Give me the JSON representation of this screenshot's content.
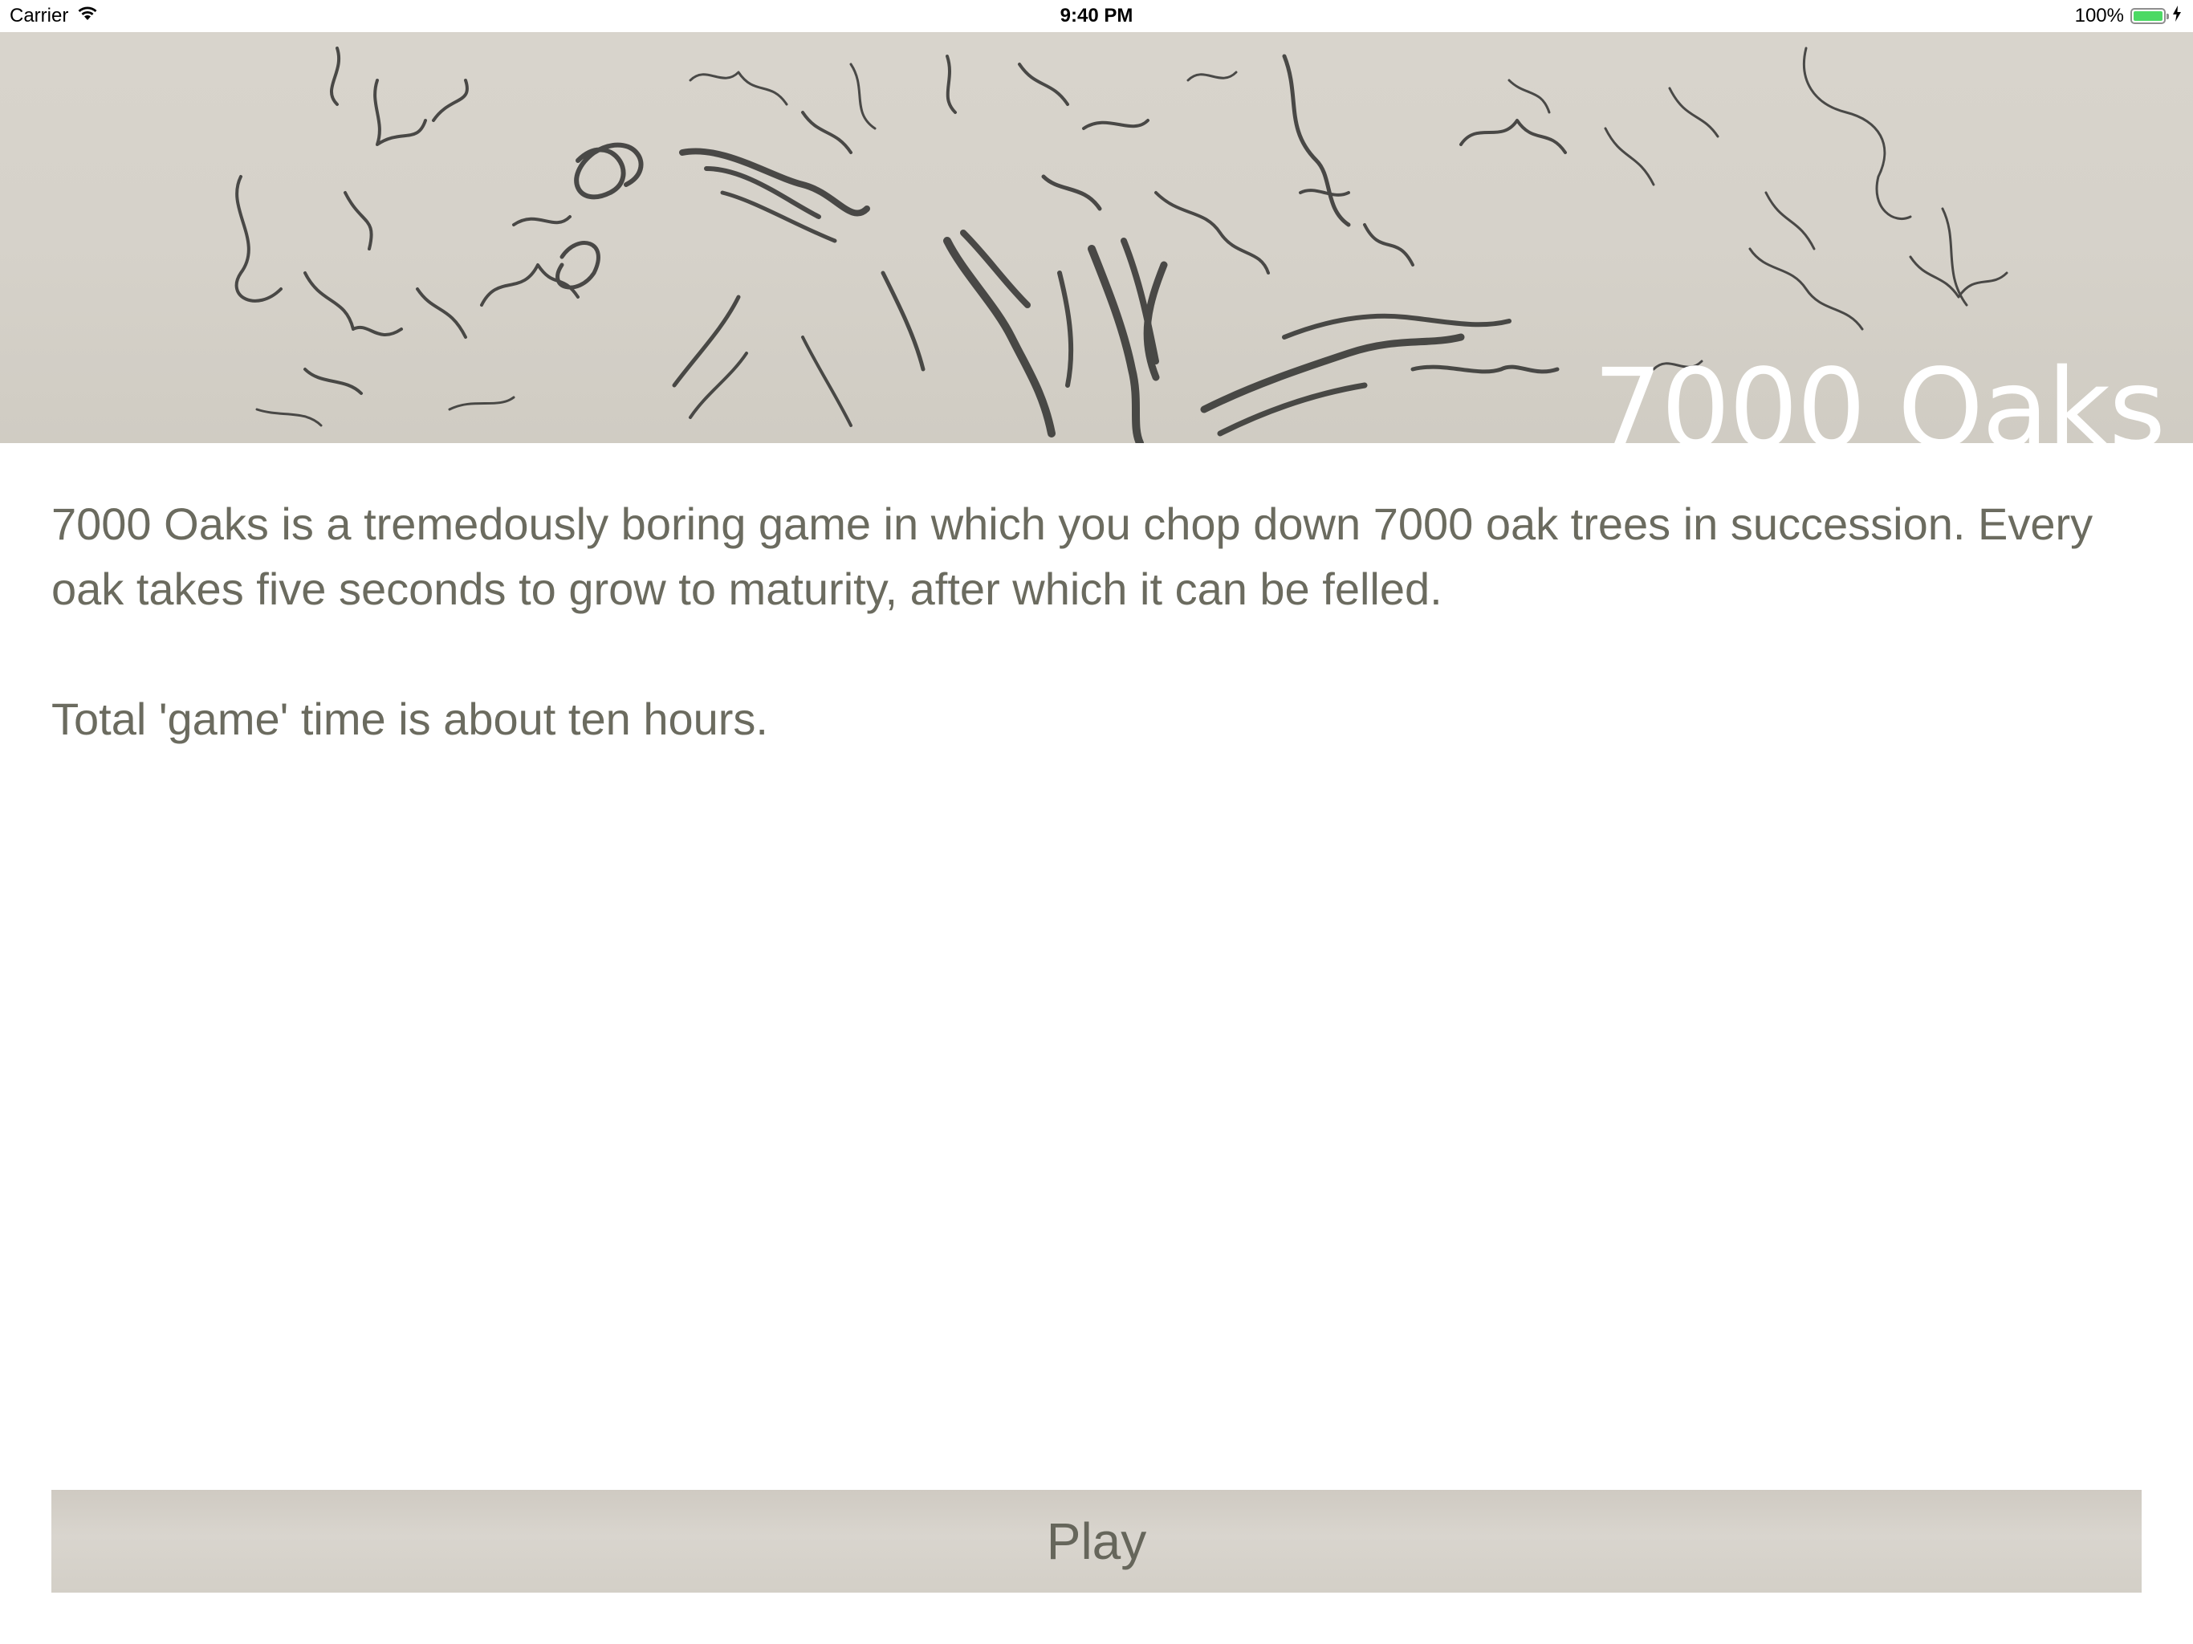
{
  "status_bar": {
    "carrier": "Carrier",
    "time": "9:40 PM",
    "battery_percent": "100%",
    "battery_level": 1.0
  },
  "banner": {
    "title": "7000 Oaks",
    "image": "oak-tree-sketch"
  },
  "description": {
    "paragraph_1": "7000 Oaks is a tremedously boring game in which you chop down 7000 oak trees in succession. Every oak takes five seconds to grow to maturity, after which it can be felled.",
    "paragraph_2": "Total 'game' time is about ten hours."
  },
  "play_button": {
    "label": "Play"
  },
  "colors": {
    "text": "#6b6b5f",
    "paper": "#d6d2ca",
    "ink": "#3a3a38",
    "battery_green": "#4cd964"
  }
}
